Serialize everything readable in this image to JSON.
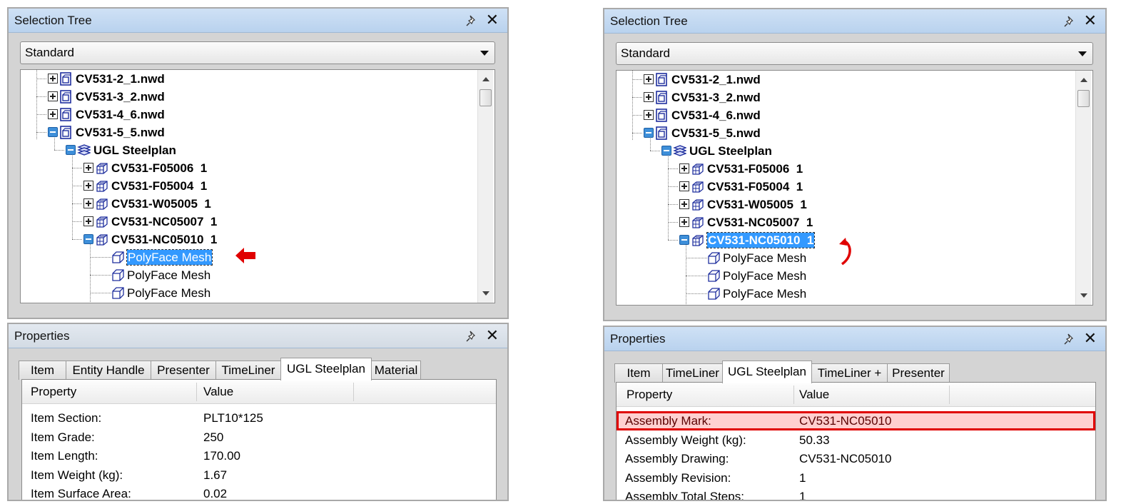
{
  "left": {
    "selection_tree": {
      "title": "Selection Tree",
      "dropdown_value": "Standard",
      "rows": [
        {
          "label": "CV531-2_1.nwd",
          "level": 0,
          "state": "plus",
          "icon": "file-icon",
          "bold": true,
          "selected": false
        },
        {
          "label": "CV531-3_2.nwd",
          "level": 0,
          "state": "plus",
          "icon": "file-icon",
          "bold": true,
          "selected": false
        },
        {
          "label": "CV531-4_6.nwd",
          "level": 0,
          "state": "plus",
          "icon": "file-icon",
          "bold": true,
          "selected": false
        },
        {
          "label": "CV531-5_5.nwd",
          "level": 0,
          "state": "minus",
          "icon": "file-icon",
          "bold": true,
          "selected": false
        },
        {
          "label": "UGL Steelplan",
          "level": 1,
          "state": "minus",
          "icon": "layer-icon",
          "bold": true,
          "selected": false
        },
        {
          "label": "CV531-F05006  1",
          "level": 2,
          "state": "plus",
          "icon": "group-icon",
          "bold": true,
          "selected": false
        },
        {
          "label": "CV531-F05004  1",
          "level": 2,
          "state": "plus",
          "icon": "group-icon",
          "bold": true,
          "selected": false
        },
        {
          "label": "CV531-W05005  1",
          "level": 2,
          "state": "plus",
          "icon": "group-icon",
          "bold": true,
          "selected": false
        },
        {
          "label": "CV531-NC05007  1",
          "level": 2,
          "state": "plus",
          "icon": "group-icon",
          "bold": true,
          "selected": false
        },
        {
          "label": "CV531-NC05010  1",
          "level": 2,
          "state": "minus",
          "icon": "group-icon",
          "bold": true,
          "selected": false
        },
        {
          "label": "PolyFace Mesh",
          "level": 3,
          "state": "none",
          "icon": "geometry-icon",
          "bold": false,
          "selected": true
        },
        {
          "label": "PolyFace Mesh",
          "level": 3,
          "state": "none",
          "icon": "geometry-icon",
          "bold": false,
          "selected": false
        },
        {
          "label": "PolyFace Mesh",
          "level": 3,
          "state": "none",
          "icon": "geometry-icon",
          "bold": false,
          "selected": false
        }
      ]
    },
    "properties": {
      "title": "Properties",
      "tabs": [
        "Item",
        "Entity Handle",
        "Presenter",
        "TimeLiner",
        "UGL Steelplan",
        "Material"
      ],
      "active_tab": 4,
      "col_property": "Property",
      "col_value": "Value",
      "rows": [
        {
          "property": "Item Section:",
          "value": "PLT10*125",
          "highlight": false
        },
        {
          "property": "Item Grade:",
          "value": "250",
          "highlight": false
        },
        {
          "property": "Item Length:",
          "value": "170.00",
          "highlight": false
        },
        {
          "property": "Item Weight (kg):",
          "value": "1.67",
          "highlight": false
        },
        {
          "property": "Item Surface Area:",
          "value": "0.02",
          "highlight": false
        }
      ]
    }
  },
  "right": {
    "selection_tree": {
      "title": "Selection Tree",
      "dropdown_value": "Standard",
      "rows": [
        {
          "label": "CV531-2_1.nwd",
          "level": 0,
          "state": "plus",
          "icon": "file-icon",
          "bold": true,
          "selected": false
        },
        {
          "label": "CV531-3_2.nwd",
          "level": 0,
          "state": "plus",
          "icon": "file-icon",
          "bold": true,
          "selected": false
        },
        {
          "label": "CV531-4_6.nwd",
          "level": 0,
          "state": "plus",
          "icon": "file-icon",
          "bold": true,
          "selected": false
        },
        {
          "label": "CV531-5_5.nwd",
          "level": 0,
          "state": "minus",
          "icon": "file-icon",
          "bold": true,
          "selected": false
        },
        {
          "label": "UGL Steelplan",
          "level": 1,
          "state": "minus",
          "icon": "layer-icon",
          "bold": true,
          "selected": false
        },
        {
          "label": "CV531-F05006  1",
          "level": 2,
          "state": "plus",
          "icon": "group-icon",
          "bold": true,
          "selected": false
        },
        {
          "label": "CV531-F05004  1",
          "level": 2,
          "state": "plus",
          "icon": "group-icon",
          "bold": true,
          "selected": false
        },
        {
          "label": "CV531-W05005  1",
          "level": 2,
          "state": "plus",
          "icon": "group-icon",
          "bold": true,
          "selected": false
        },
        {
          "label": "CV531-NC05007  1",
          "level": 2,
          "state": "plus",
          "icon": "group-icon",
          "bold": true,
          "selected": false
        },
        {
          "label": "CV531-NC05010  1",
          "level": 2,
          "state": "minus",
          "icon": "group-icon",
          "bold": true,
          "selected": true
        },
        {
          "label": "PolyFace Mesh",
          "level": 3,
          "state": "none",
          "icon": "geometry-icon",
          "bold": false,
          "selected": false
        },
        {
          "label": "PolyFace Mesh",
          "level": 3,
          "state": "none",
          "icon": "geometry-icon",
          "bold": false,
          "selected": false
        },
        {
          "label": "PolyFace Mesh",
          "level": 3,
          "state": "none",
          "icon": "geometry-icon",
          "bold": false,
          "selected": false
        }
      ]
    },
    "properties": {
      "title": "Properties",
      "tabs": [
        "Item",
        "TimeLiner",
        "UGL Steelplan",
        "TimeLiner +",
        "Presenter"
      ],
      "active_tab": 2,
      "col_property": "Property",
      "col_value": "Value",
      "rows": [
        {
          "property": "Assembly Mark:",
          "value": "CV531-NC05010",
          "highlight": true
        },
        {
          "property": "Assembly Weight (kg):",
          "value": "50.33",
          "highlight": false
        },
        {
          "property": "Assembly Drawing:",
          "value": "CV531-NC05010",
          "highlight": false
        },
        {
          "property": "Assembly Revision:",
          "value": "1",
          "highlight": false
        },
        {
          "property": "Assembly Total Steps:",
          "value": "1",
          "highlight": false
        }
      ]
    }
  },
  "annotation_color": "#e00000",
  "highlight_color": "#3399ff"
}
